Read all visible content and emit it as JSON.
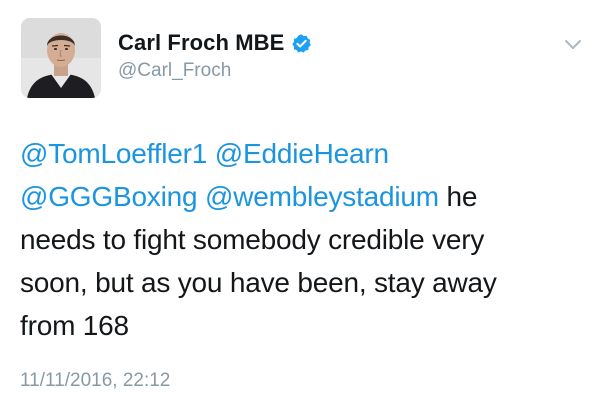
{
  "user": {
    "display_name": "Carl Froch MBE",
    "handle": "@Carl_Froch",
    "verified": true,
    "verified_color": "#1da1f2"
  },
  "tweet": {
    "mentions": [
      "@TomLoeffler1",
      "@EddieHearn",
      "@GGGBoxing",
      "@wembleystadium"
    ],
    "text_after_mentions": " he",
    "text_lines": [
      "needs to fight somebody credible very",
      "soon, but as you have been, stay away",
      "from 168"
    ],
    "timestamp": "11/11/2016, 22:12"
  },
  "colors": {
    "link": "#1b95e0",
    "muted": "#8899a6",
    "text": "#14171a"
  },
  "icons": {
    "verified": "verified-badge-icon",
    "menu": "chevron-down-icon"
  }
}
